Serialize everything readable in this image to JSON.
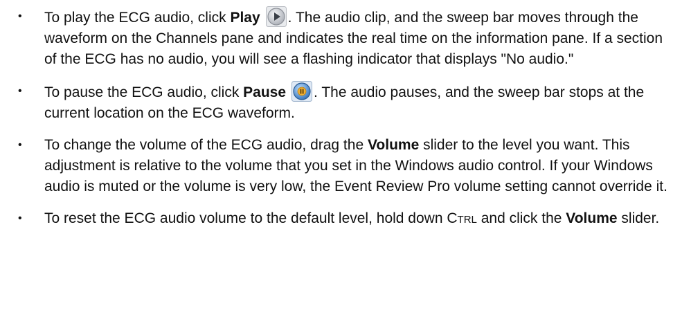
{
  "bullet_glyph": "•",
  "items": [
    {
      "t1": "To play the ECG audio, click ",
      "b1": "Play",
      "icon": "play-button-icon",
      "t2": ". The audio clip, and the sweep bar moves through the waveform on the Channels pane and indicates the real time on the information pane. If a section of the ECG has no audio, you will see a flashing indicator that displays \"No audio.\""
    },
    {
      "t1": "To pause the ECG audio, click ",
      "b1": "Pause",
      "icon": "pause-button-icon",
      "t2": ". The audio pauses, and the sweep bar stops at the current location on the ECG waveform."
    },
    {
      "t1": "To change the volume of the ECG audio, drag the ",
      "b1": "Volume",
      "t2": " slider to the level you want. This adjustment is relative to the volume that you set in the Windows audio control. If your Windows audio is muted or the volume is very low, the Event Review Pro volume setting cannot override it."
    },
    {
      "t1": "To reset the ECG audio volume to the default level, hold down ",
      "key": "Ctrl",
      "t2": " and click the ",
      "b1": "Volume",
      "t3": " slider."
    }
  ],
  "colors": {
    "play_icon_fill": "#c9ccd2",
    "pause_icon_fill": "#4f8fd6",
    "pause_icon_bars": "#f2b134"
  }
}
